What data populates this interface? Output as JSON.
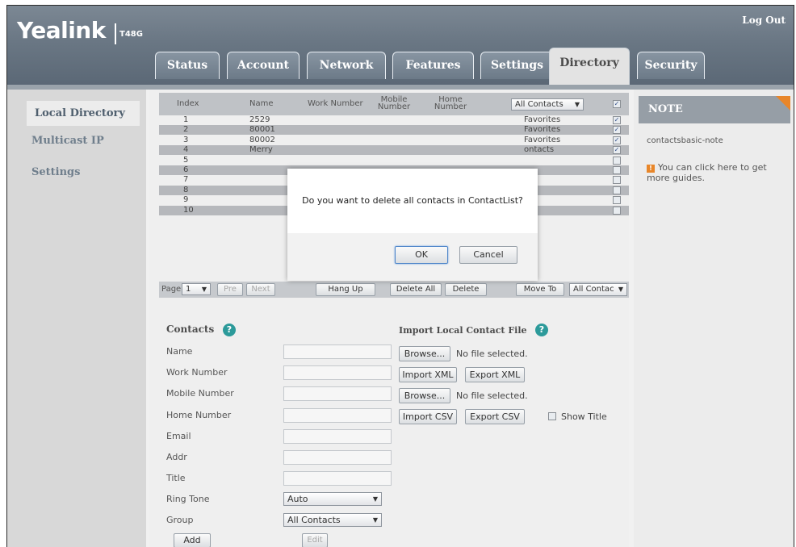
{
  "header": {
    "logo": "Yealink",
    "model": "T48G",
    "logout": "Log Out",
    "tabs": [
      "Status",
      "Account",
      "Network",
      "Features",
      "Settings",
      "Directory",
      "Security"
    ]
  },
  "sidebar": {
    "items": [
      "Local Directory",
      "Multicast IP",
      "Settings"
    ]
  },
  "table": {
    "headers": {
      "index": "Index",
      "name": "Name",
      "work": "Work Number",
      "mobile": "Mobile Number",
      "home": "Home Number",
      "group_filter": "All Contacts"
    },
    "rows": [
      {
        "index": "1",
        "name": "2529",
        "group": "Favorites",
        "checked": true
      },
      {
        "index": "2",
        "name": "80001",
        "group": "Favorites",
        "checked": true
      },
      {
        "index": "3",
        "name": "80002",
        "group": "Favorites",
        "checked": true
      },
      {
        "index": "4",
        "name": "Merry",
        "group": "ontacts",
        "checked": true
      },
      {
        "index": "5",
        "name": "",
        "group": "",
        "checked": false
      },
      {
        "index": "6",
        "name": "",
        "group": "",
        "checked": false
      },
      {
        "index": "7",
        "name": "",
        "group": "",
        "checked": false
      },
      {
        "index": "8",
        "name": "",
        "group": "",
        "checked": false
      },
      {
        "index": "9",
        "name": "",
        "group": "",
        "checked": false
      },
      {
        "index": "10",
        "name": "",
        "group": "",
        "checked": false
      }
    ]
  },
  "pager": {
    "page_label": "Page",
    "page_value": "1",
    "prev": "Pre",
    "next": "Next",
    "hang_up": "Hang Up",
    "delete_all": "Delete All",
    "delete": "Delete",
    "move_to": "Move To",
    "move_group": "All Contac"
  },
  "contacts": {
    "title": "Contacts",
    "labels": [
      "Name",
      "Work Number",
      "Mobile Number",
      "Home Number",
      "Email",
      "Addr",
      "Title",
      "Ring Tone",
      "Group"
    ],
    "ring_tone": "Auto",
    "group": "All Contacts",
    "add": "Add",
    "edit": "Edit"
  },
  "import": {
    "title": "Import Local Contact File",
    "browse": "Browse...",
    "no_file": "No file selected.",
    "import_xml": "Import XML",
    "export_xml": "Export XML",
    "import_csv": "Import CSV",
    "export_csv": "Export CSV",
    "show_title": "Show Title"
  },
  "note": {
    "title": "NOTE",
    "text": "contactsbasic-note",
    "guide": "You can click here to get more guides."
  },
  "dialog": {
    "message": "Do you want to delete all contacts in ContactList?",
    "ok": "OK",
    "cancel": "Cancel"
  },
  "colors": {
    "header": "#6a7784",
    "accent": "#e8862a",
    "help": "#2c9a9a"
  }
}
